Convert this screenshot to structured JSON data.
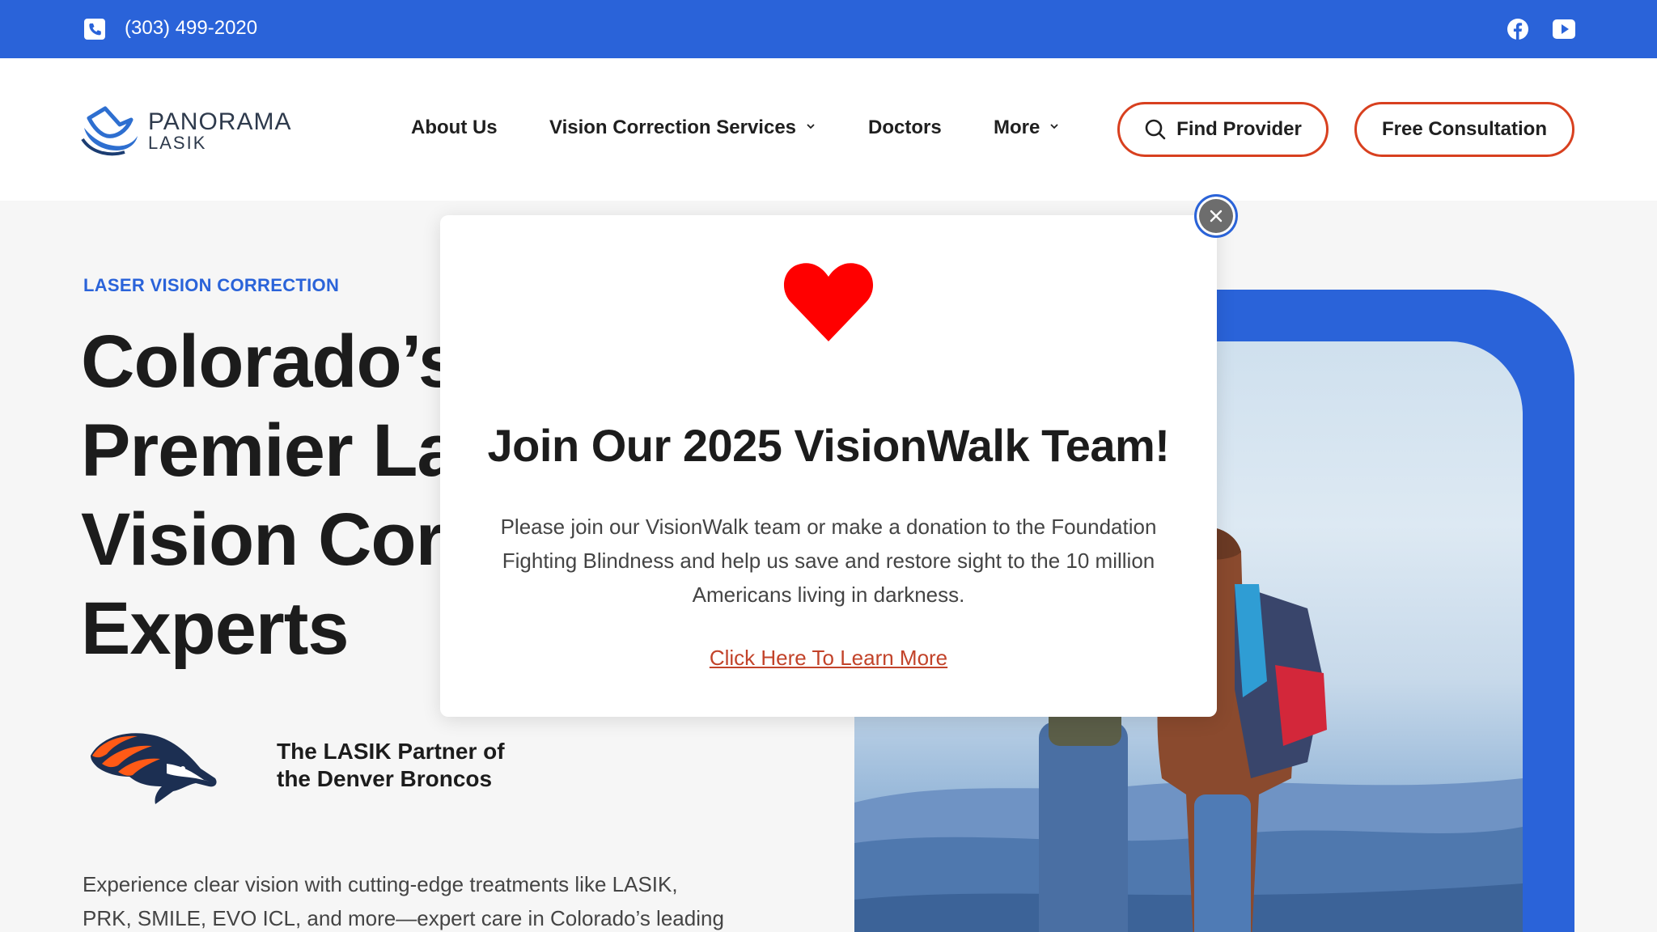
{
  "topbar": {
    "phone": "(303) 499-2020",
    "icons": [
      "phone-icon",
      "facebook-icon",
      "youtube-icon"
    ]
  },
  "header": {
    "logo_name": "PANORAMA",
    "logo_sub": "LASIK",
    "nav": {
      "about": "About Us",
      "vision": "Vision Correction Services",
      "doctors": "Doctors",
      "more": "More"
    },
    "find_provider": "Find Provider",
    "free_consultation": "Free Consultation"
  },
  "hero": {
    "eyebrow": "LASER VISION CORRECTION",
    "title_lines": [
      "Colorado’s",
      "Premier La",
      "Vision Cor",
      "Experts"
    ],
    "partner_line1": "The LASIK Partner of",
    "partner_line2": "the Denver Broncos",
    "description_line1": "Experience clear vision with cutting-edge treatments like LASIK,",
    "description_line2": "PRK, SMILE, EVO ICL, and more—expert care in Colorado’s leading"
  },
  "modal": {
    "title": "Join Our 2025 VisionWalk Team!",
    "text_line1": "Please join our VisionWalk team or make a donation to the Foundation",
    "text_line2": "Fighting Blindness and help us save and restore sight to the 10 million",
    "text_line3": "Americans living in darkness.",
    "link": "Click Here To Learn More"
  },
  "colors": {
    "brand_blue": "#2a63d9",
    "accent_orange": "#d8401f",
    "link_red": "#c2432a",
    "heart_red": "#ff0000"
  }
}
